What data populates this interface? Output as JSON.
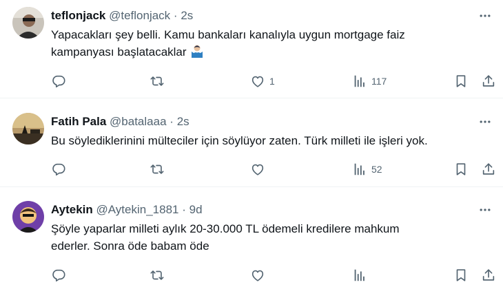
{
  "tweets": [
    {
      "display_name": "teflonjack",
      "handle": "@teflonjack",
      "sep": "·",
      "time": "2s",
      "text_line1": "Yapacakları şey belli. Kamu bankaları kanalıyla uygun mortgage faiz",
      "text_line2": "kampanyası başlatacaklar",
      "replies": "",
      "retweets": "",
      "likes": "1",
      "views": "117"
    },
    {
      "display_name": "Fatih Pala",
      "handle": "@batalaaa",
      "sep": "·",
      "time": "2s",
      "text_line1": "Bu söylediklerinini mülteciler için söylüyor zaten. Türk milleti ile işleri yok.",
      "replies": "",
      "retweets": "",
      "likes": "",
      "views": "52"
    },
    {
      "display_name": "Aytekin",
      "handle": "@Aytekin_1881",
      "sep": "·",
      "time": "9d",
      "text_line1": "Şöyle yaparlar milleti aylık 20-30.000 TL ödemeli kredilere mahkum",
      "text_line2": "ederler. Sonra öde babam öde",
      "replies": "",
      "retweets": "",
      "likes": "",
      "views": ""
    }
  ],
  "icons": {
    "reply": "reply-icon",
    "retweet": "retweet-icon",
    "like": "heart-icon",
    "views": "views-icon",
    "bookmark": "bookmark-icon",
    "share": "share-icon",
    "more": "more-icon"
  },
  "colors": {
    "text": "#0f1419",
    "secondary": "#536471",
    "divider": "#eff3f4"
  }
}
